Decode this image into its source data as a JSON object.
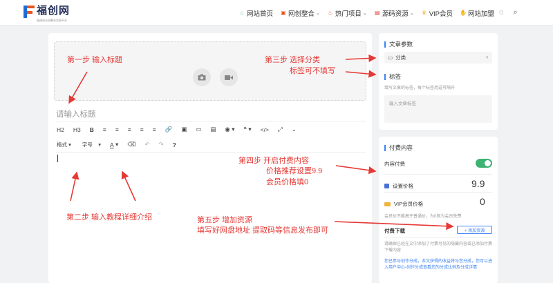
{
  "header": {
    "logo_text": "福创网",
    "logo_sub": "福建创业网整合资源平台",
    "nav": [
      {
        "label": "网站首页",
        "icon": "home-icon",
        "caret": false
      },
      {
        "label": "网创整合",
        "icon": "box-icon",
        "caret": true
      },
      {
        "label": "热门项目",
        "icon": "fire-icon",
        "caret": true
      },
      {
        "label": "源码资源",
        "icon": "code-icon",
        "caret": true
      },
      {
        "label": "VIP会员",
        "icon": "crown-icon",
        "caret": false
      },
      {
        "label": "网站加盟",
        "icon": "handshake-icon",
        "caret": false
      }
    ]
  },
  "editor": {
    "title_placeholder": "请输入标题",
    "toolbar1": [
      "H2",
      "H3",
      "B",
      "≡",
      "≡",
      "≡",
      "≡",
      "≡",
      "🔗",
      "▣",
      "▭",
      "▤",
      "◉ ▾",
      "❝ ▾",
      "</>",
      "⤢",
      "⌄"
    ],
    "toolbar2": [
      {
        "label": "格式",
        "caret": true
      },
      {
        "label": "字号",
        "caret": true
      },
      {
        "label": "A",
        "caret": true
      },
      {
        "label": "⌫",
        "caret": false
      },
      {
        "label": "↶",
        "caret": false
      },
      {
        "label": "↷",
        "caret": false
      },
      {
        "label": "?",
        "caret": false
      }
    ]
  },
  "side1": {
    "section_title": "文章参数",
    "category": "分类",
    "tag_title": "标签",
    "tag_hint": "填写文章的标签，每个标签用逗号隔开",
    "tag_placeholder": "输入文章标签"
  },
  "side2": {
    "section_title": "付费内容",
    "paid_label": "内容付费",
    "price_label": "设置价格",
    "price_value": "9.9",
    "vip_label": "VIP会员价格",
    "vip_value": "0",
    "vip_hint": "会员价不能高于普通价，为0则为会员免费",
    "download_label": "付费下载",
    "add_button": "+ 添加资源",
    "note_gray": "请确保已经在文中添加了付费可见的隐藏内容或已添加付费下载内容",
    "note_blue": "您已参与创作分成，本文获得的收益将与您分成，您可以进入用户中心-创作分成查看您的分成比例及分成详情"
  },
  "annotations": {
    "step1": "第一步  输入标题",
    "step2": "第二步  输入教程详细介绍",
    "step3_a": "第三步    选择分类",
    "step3_b": "标签可不填写",
    "step4_a": "第四步    开启付费内容",
    "step4_b": "价格推荐设置9.9",
    "step4_c": "会员价格填0",
    "step5_a": "第五步  增加资源",
    "step5_b": "填写好网盘地址  提取码等信息发布即可"
  },
  "colors": {
    "accent": "#3b82f6",
    "annotation": "#e53935",
    "toggle": "#3cb371"
  }
}
